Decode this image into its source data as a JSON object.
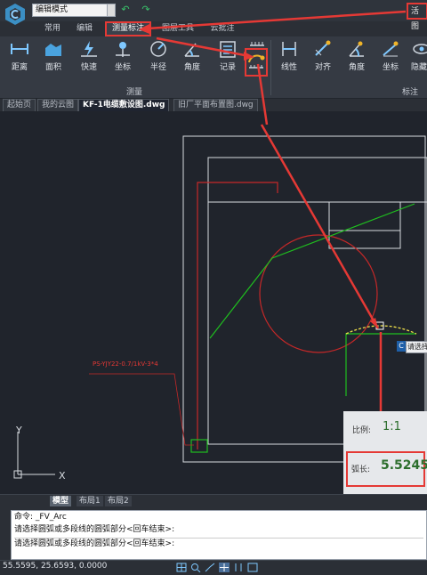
{
  "titlebar": {
    "mode_select_value": "编辑模式",
    "undo_icon": "undo-icon",
    "redo_icon": "redo-icon",
    "activate_label": "活图"
  },
  "menu_tabs": [
    {
      "label": "常用"
    },
    {
      "label": "编辑"
    },
    {
      "label": "测量标注",
      "active": true
    },
    {
      "label": "图层工具"
    },
    {
      "label": "云批注"
    }
  ],
  "ribbon": {
    "measure_group_label": "测量",
    "dimension_group_label": "标注",
    "measure_tools": [
      {
        "label": "距离",
        "icon": "distance-icon"
      },
      {
        "label": "面积",
        "icon": "area-icon"
      },
      {
        "label": "快速",
        "icon": "quick-measure-icon"
      },
      {
        "label": "坐标",
        "icon": "coordinate-icon"
      },
      {
        "label": "半径",
        "icon": "radius-icon"
      },
      {
        "label": "角度",
        "icon": "angle-icon"
      },
      {
        "label": "记录",
        "icon": "record-icon"
      }
    ],
    "arc_length_tool": {
      "icon": "arc-length-icon",
      "highlighted": true
    },
    "dimension_tools": [
      {
        "label": "线性",
        "icon": "linear-dim-icon"
      },
      {
        "label": "对齐",
        "icon": "aligned-dim-icon"
      },
      {
        "label": "角度",
        "icon": "angle-dim-icon"
      },
      {
        "label": "坐标",
        "icon": "coordinate-dim-icon"
      },
      {
        "label": "隐藏",
        "icon": "hide-dim-icon"
      }
    ]
  },
  "doc_tabs": [
    {
      "label": "起始页"
    },
    {
      "label": "我的云图"
    },
    {
      "label": "KF-1电缆敷设图.dwg",
      "active": true
    },
    {
      "label": "旧厂平面布置图.dwg"
    }
  ],
  "drawing": {
    "annotation_text": "PS-YJY22-0.7/1kV-3*4",
    "prompt_tip": "请选择"
  },
  "properties_panel": {
    "scale_label": "比例:",
    "scale_value": "1:1",
    "arc_length_label": "弧长:",
    "arc_length_value": "5.5245"
  },
  "layout_tabs": [
    {
      "label": "模型",
      "active": true
    },
    {
      "label": "布局1"
    },
    {
      "label": "布局2"
    }
  ],
  "command_history": [
    "命令: _FV_Arc",
    "请选择圆弧或多段线的圆弧部分<回车结束>:",
    "请选择圆弧或多段线的圆弧部分<回车结束>:"
  ],
  "status": {
    "coordinates": "55.5595, 25.6593, 0.0000"
  },
  "colors": {
    "accent_red": "#e53935",
    "green_line": "#1fbf1f",
    "canvas_bg": "#20242c"
  }
}
